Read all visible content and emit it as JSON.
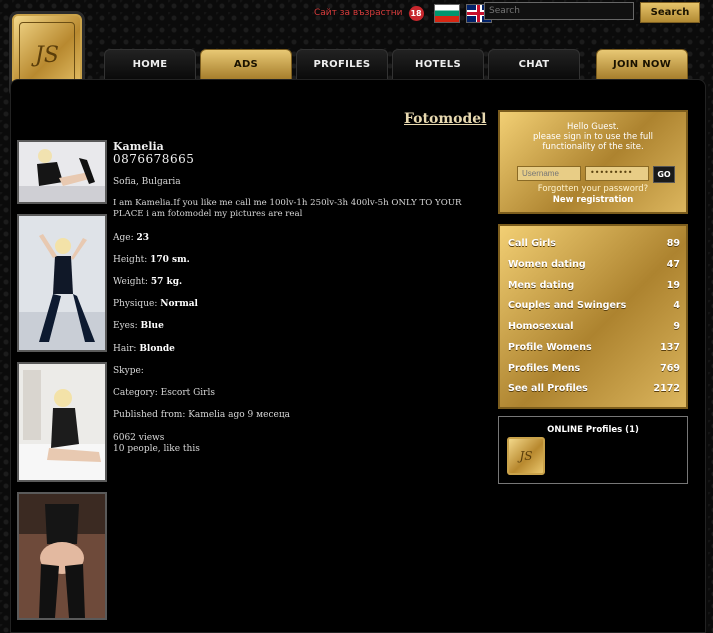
{
  "header": {
    "logo_text": "JS",
    "adult_link": "Сайт за възрастни",
    "age_badge": "18",
    "search_placeholder": "Search",
    "search_button": "Search"
  },
  "nav": {
    "items": [
      {
        "label": "HOME"
      },
      {
        "label": "ADS"
      },
      {
        "label": "PROFILES"
      },
      {
        "label": "HOTELS"
      },
      {
        "label": "CHAT"
      },
      {
        "label": "JOIN NOW"
      }
    ]
  },
  "page": {
    "title": "Fotomodel"
  },
  "profile": {
    "name": "Kamelia",
    "phone": "0876678665",
    "location": "Sofia, Bulgaria",
    "description": "I am Kamelia.If you like me call me 100lv-1h 250lv-3h 400lv-5h ONLY TO YOUR PLACE i am fotomodel my pictures are real",
    "age_label": "Age:",
    "age": "23",
    "height_label": "Height:",
    "height": "170 sm.",
    "weight_label": "Weight:",
    "weight": "57 kg.",
    "physique_label": "Physique:",
    "physique": "Normal",
    "eyes_label": "Eyes:",
    "eyes": "Blue",
    "hair_label": "Hair:",
    "hair": "Blonde",
    "skype_label": "Skype:",
    "category_label": "Category:",
    "category": "Escort Girls",
    "published": "Published from: Kamelia ago 9 месеца",
    "views": "6062 views",
    "likes": "10 people, like this"
  },
  "login": {
    "hello": "Hello Guest.",
    "message": "please sign in to use the full functionality of the site.",
    "username_placeholder": "Username",
    "password_value": "•••••••••",
    "go_button": "GO",
    "forgot": "Forgotten your password?",
    "register": "New registration"
  },
  "categories": [
    {
      "label": "Call Girls",
      "count": "89"
    },
    {
      "label": "Women dating",
      "count": "47"
    },
    {
      "label": "Mens dating",
      "count": "19"
    },
    {
      "label": "Couples and Swingers",
      "count": "4"
    },
    {
      "label": "Homosexual",
      "count": "9"
    },
    {
      "label": "Profile Womens",
      "count": "137"
    },
    {
      "label": "Profiles Mens",
      "count": "769"
    },
    {
      "label": "See all Profiles",
      "count": "2172"
    }
  ],
  "online": {
    "title": "ONLINE Profiles (1)",
    "avatar_text": "JS"
  },
  "colors": {
    "gold": "#c9a24a",
    "alert": "#d83c3c",
    "background": "#000000"
  }
}
